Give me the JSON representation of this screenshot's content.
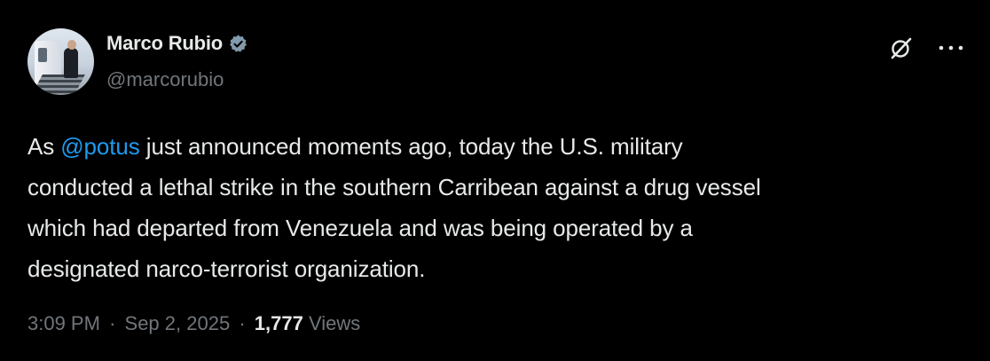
{
  "author": {
    "display_name": "Marco Rubio",
    "handle": "@marcorubio",
    "verified": true
  },
  "icons": {
    "verified": "verified-badge-icon",
    "grok": "grok-icon",
    "more": "more-options-icon"
  },
  "tweet": {
    "line1_prefix": "As ",
    "mention": "@potus",
    "line1_suffix": " just announced moments ago, today the U.S. military",
    "line2": "conducted a lethal strike in the southern Carribean against a drug vessel",
    "line3": "which had departed from Venezuela and was being operated by a",
    "line4": "designated narco-terrorist organization."
  },
  "meta": {
    "time": "3:09 PM",
    "separator": "·",
    "date": "Sep 2, 2025",
    "views_count": "1,777",
    "views_label": "Views"
  },
  "colors": {
    "background": "#000000",
    "text": "#e7e9ea",
    "secondary": "#71767b",
    "link": "#1d9bf0",
    "verified": "#829aab"
  }
}
